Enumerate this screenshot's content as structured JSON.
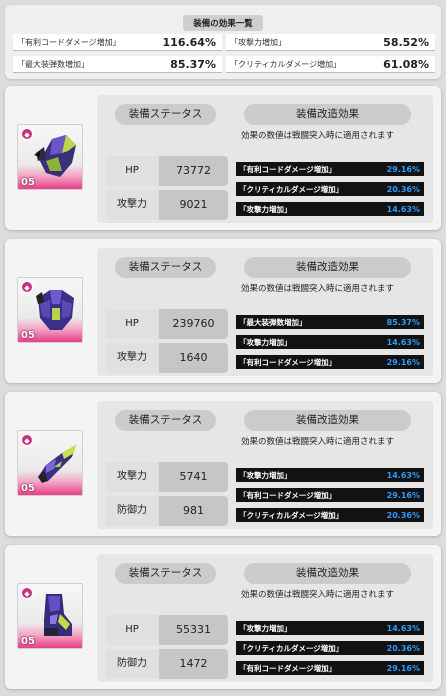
{
  "summary": {
    "title": "装備の効果一覧",
    "left": [
      {
        "name": "「有利コードダメージ増加」",
        "value": "116.64%"
      },
      {
        "name": "「最大装弾数増加」",
        "value": "85.37%"
      }
    ],
    "right": [
      {
        "name": "「攻撃力増加」",
        "value": "58.52%"
      },
      {
        "name": "「クリティカルダメージ増加」",
        "value": "61.08%"
      }
    ]
  },
  "cards": [
    {
      "level": "05",
      "status_label": "装備ステータス",
      "mod_label": "装備改造効果",
      "note": "効果の数値は戦闘突入時に適用されます",
      "stats": [
        {
          "label": "HP",
          "value": "73772"
        },
        {
          "label": "攻撃力",
          "value": "9021"
        }
      ],
      "effects": [
        {
          "name": "「有利コードダメージ増加」",
          "value": "29.16%"
        },
        {
          "name": "「クリティカルダメージ増加」",
          "value": "20.36%"
        },
        {
          "name": "「攻撃力増加」",
          "value": "14.63%"
        }
      ]
    },
    {
      "level": "05",
      "status_label": "装備ステータス",
      "mod_label": "装備改造効果",
      "note": "効果の数値は戦闘突入時に適用されます",
      "stats": [
        {
          "label": "HP",
          "value": "239760"
        },
        {
          "label": "攻撃力",
          "value": "1640"
        }
      ],
      "effects": [
        {
          "name": "「最大装弾数増加」",
          "value": "85.37%"
        },
        {
          "name": "「攻撃力増加」",
          "value": "14.63%"
        },
        {
          "name": "「有利コードダメージ増加」",
          "value": "29.16%"
        }
      ]
    },
    {
      "level": "05",
      "status_label": "装備ステータス",
      "mod_label": "装備改造効果",
      "note": "効果の数値は戦闘突入時に適用されます",
      "stats": [
        {
          "label": "攻撃力",
          "value": "5741"
        },
        {
          "label": "防御力",
          "value": "981"
        }
      ],
      "effects": [
        {
          "name": "「攻撃力増加」",
          "value": "14.63%"
        },
        {
          "name": "「有利コードダメージ増加」",
          "value": "29.16%"
        },
        {
          "name": "「クリティカルダメージ増加」",
          "value": "20.36%"
        }
      ]
    },
    {
      "level": "05",
      "status_label": "装備ステータス",
      "mod_label": "装備改造効果",
      "note": "効果の数値は戦闘突入時に適用されます",
      "stats": [
        {
          "label": "HP",
          "value": "55331"
        },
        {
          "label": "防御力",
          "value": "1472"
        }
      ],
      "effects": [
        {
          "name": "「攻撃力増加」",
          "value": "14.63%"
        },
        {
          "name": "「クリティカルダメージ増加」",
          "value": "20.36%"
        },
        {
          "name": "「有利コードダメージ増加」",
          "value": "29.16%"
        }
      ]
    }
  ],
  "colors": {
    "effect_value": "#2f9bff",
    "effect_bar": "#121212",
    "rarity_pink": "#e63f86"
  },
  "icons": [
    "rarity-gem-icon",
    "helmet-equipment-icon",
    "armor-equipment-icon",
    "gloves-equipment-icon",
    "boots-equipment-icon"
  ]
}
